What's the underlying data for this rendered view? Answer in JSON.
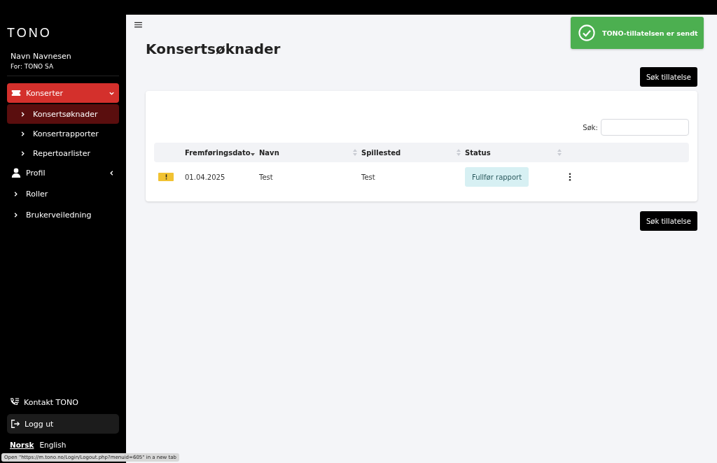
{
  "sidebar": {
    "logo": "TONO",
    "user_name": "Navn Navnesen",
    "organization": "For: TONO SA",
    "items": [
      {
        "kind": "ticket",
        "label": "Konserter",
        "selected": true,
        "expanded": true,
        "children": [
          {
            "label": "Konsertsøknader",
            "selected": true
          },
          {
            "label": "Konsertrapporter",
            "selected": false
          },
          {
            "label": "Repertoarlister",
            "selected": false
          }
        ]
      },
      {
        "kind": "person",
        "label": "Profil",
        "selected": false,
        "expanded": false
      },
      {
        "kind": "link",
        "label": "Roller",
        "selected": false
      },
      {
        "kind": "link",
        "label": "Brukerveiledning",
        "selected": false
      }
    ],
    "contact": "Kontakt TONO",
    "logout": "Logg ut",
    "languages": [
      {
        "label": "Norsk",
        "selected": true
      },
      {
        "label": "English",
        "selected": false
      }
    ]
  },
  "page_title": "Konsertsøknader",
  "apply_button_top": "Søk tillatelse",
  "apply_button_bottom": "Søk tillatelse",
  "search": {
    "label": "Søk:"
  },
  "table": {
    "columns": [
      {
        "label": "Fremføringsdato",
        "sorted_descending": true
      },
      {
        "label": "Navn",
        "sorted_descending": false
      },
      {
        "label": "Spillested",
        "sorted_descending": false
      },
      {
        "label": "Status",
        "sorted_descending": false
      }
    ],
    "rows": [
      {
        "warning": true,
        "date": "01.04.2025",
        "name": "Test",
        "venue": "Test",
        "status": "Fullfør rapport"
      }
    ]
  },
  "toast": {
    "message": "TONO-tillatelsen er sendt"
  },
  "status_bar": "Open \"https://m.tono.no/Login/Logout.php?menuid=605\" in a new tab"
}
